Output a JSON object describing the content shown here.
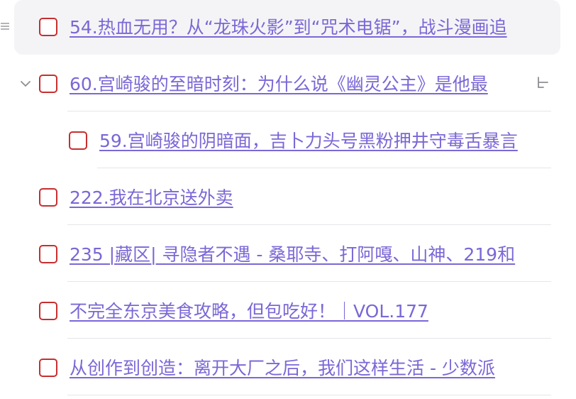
{
  "tasks": [
    {
      "title": "54.热血无用？从“龙珠火影”到“咒术电锯”，战斗漫画追"
    },
    {
      "title": "60.宫崎骏的至暗时刻：为什么说《幽灵公主》是他最"
    },
    {
      "title": "59.宫崎骏的阴暗面，吉卜力头号黑粉押井守毒舌暴言"
    },
    {
      "title": "222.我在北京送外卖"
    },
    {
      "title": "235 |藏区| 寻隐者不遇 - 桑耶寺、打阿嘎、山神、219和"
    },
    {
      "title": "不完全东京美食攻略，但包吃好！｜VOL.177"
    },
    {
      "title": "从创作到创造：离开大厂之后，我们这样生活 - 少数派"
    }
  ],
  "colors": {
    "checkbox_border": "#c62f2f",
    "link": "#7b67d6",
    "hover_bg": "#f4f4f6",
    "divider": "#e6e6ea"
  },
  "icons": {
    "drag": "drag-handle-icon",
    "collapse": "chevron-down-icon",
    "subtask": "subtask-icon"
  }
}
